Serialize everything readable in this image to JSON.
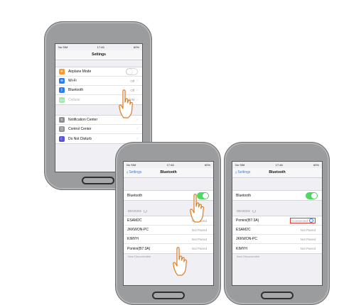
{
  "status": {
    "carrier": "No SIM",
    "time": "17:46",
    "battery": "60%"
  },
  "phone1": {
    "title": "Settings",
    "rows_group1": [
      {
        "label": "Airplane Mode",
        "value": "",
        "icon": "airplane-icon",
        "color": "#f79a2c",
        "glyph": "✈"
      },
      {
        "label": "Wi-Fi",
        "value": "Off",
        "icon": "wifi-icon",
        "color": "#2d7cf6",
        "glyph": "≋"
      },
      {
        "label": "Bluetooth",
        "value": "Off",
        "icon": "bluetooth-icon",
        "color": "#2d7cf6",
        "glyph": "ᛒ"
      },
      {
        "label": "Cellular",
        "value": "No SIM",
        "icon": "cellular-icon",
        "color": "#4cd964",
        "glyph": "((•))"
      }
    ],
    "rows_group2": [
      {
        "label": "Notification Center",
        "icon": "notification-center-icon",
        "color": "#8e8e93",
        "glyph": "≡"
      },
      {
        "label": "Control Center",
        "icon": "control-center-icon",
        "color": "#8e8e93",
        "glyph": "◫"
      },
      {
        "label": "Do Not Disturb",
        "icon": "moon-icon",
        "color": "#5856d6",
        "glyph": "☾"
      }
    ]
  },
  "phone2": {
    "back_label": "Settings",
    "title": "Bluetooth",
    "bluetooth_label": "Bluetooth",
    "devices_label": "DEVICES",
    "devices": [
      {
        "name": "ESAM2C",
        "state": "Not Paired"
      },
      {
        "name": "JKKWON-PC",
        "state": "Not Paired"
      },
      {
        "name": "KIMYH",
        "state": "Not Paired"
      },
      {
        "name": "Pomini(B7:3A)",
        "state": "Not Paired"
      }
    ],
    "footer": "Now Discoverable"
  },
  "phone3": {
    "back_label": "Settings",
    "title": "Bluetooth",
    "bluetooth_label": "Bluetooth",
    "devices_label": "DEVICES",
    "connected_device": {
      "name": "Pomini(B7:3A)",
      "state": "Connected"
    },
    "devices": [
      {
        "name": "ESAM2C",
        "state": "Not Paired"
      },
      {
        "name": "JKKWON-PC",
        "state": "Not Paired"
      },
      {
        "name": "KIMYH",
        "state": "Not Paired"
      }
    ],
    "footer": "Now Discoverable"
  },
  "colors": {
    "ios_blue": "#2d7cf6",
    "switch_green": "#4cd964",
    "highlight_red": "#e03a3a",
    "phone_body": "#9b9c9e"
  }
}
